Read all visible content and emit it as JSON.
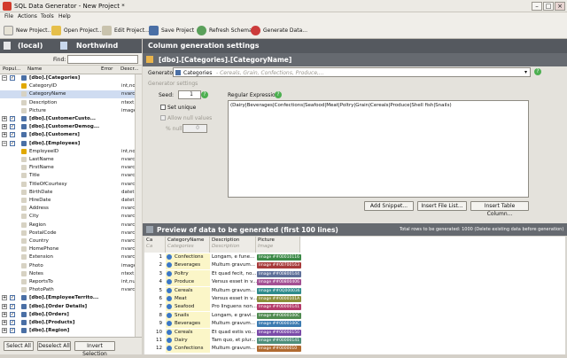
{
  "window": {
    "title": "SQL Data Generator - New Project *"
  },
  "menu": [
    "File",
    "Actions",
    "Tools",
    "Help"
  ],
  "toolbar": {
    "new": "New Project...",
    "open": "Open Project...",
    "edit": "Edit Project...",
    "save": "Save Project",
    "refresh": "Refresh Schema",
    "generate": "Generate Data..."
  },
  "left": {
    "server": "(local)",
    "database": "Northwind",
    "filter_label": "Find:",
    "columns": [
      "Popul...",
      "Name",
      "Error",
      "Descr..."
    ],
    "rows": [
      {
        "kind": "table",
        "name": "[dbo].[Categories]",
        "expanded": true,
        "checked": true
      },
      {
        "kind": "col",
        "name": "CategoryID",
        "type": "int,not"
      },
      {
        "kind": "col",
        "name": "CategoryName",
        "type": "nvarch",
        "selected": true
      },
      {
        "kind": "col",
        "name": "Description",
        "type": "ntext,n"
      },
      {
        "kind": "col",
        "name": "Picture",
        "type": "image,"
      },
      {
        "kind": "table",
        "name": "[dbo].[CustomerCusto...",
        "expanded": false,
        "checked": true
      },
      {
        "kind": "table",
        "name": "[dbo].[CustomerDemog...",
        "expanded": false,
        "checked": true
      },
      {
        "kind": "table",
        "name": "[dbo].[Customers]",
        "expanded": false,
        "checked": true
      },
      {
        "kind": "table",
        "name": "[dbo].[Employees]",
        "expanded": true,
        "checked": true
      },
      {
        "kind": "col",
        "name": "EmployeeID",
        "type": "int,not"
      },
      {
        "kind": "col",
        "name": "LastName",
        "type": "nvarch"
      },
      {
        "kind": "col",
        "name": "FirstName",
        "type": "nvarch"
      },
      {
        "kind": "col",
        "name": "Title",
        "type": "nvarch"
      },
      {
        "kind": "col",
        "name": "TitleOfCourtesy",
        "type": "nvarch"
      },
      {
        "kind": "col",
        "name": "BirthDate",
        "type": "datetin"
      },
      {
        "kind": "col",
        "name": "HireDate",
        "type": "datetin"
      },
      {
        "kind": "col",
        "name": "Address",
        "type": "nvarch"
      },
      {
        "kind": "col",
        "name": "City",
        "type": "nvarch"
      },
      {
        "kind": "col",
        "name": "Region",
        "type": "nvarch"
      },
      {
        "kind": "col",
        "name": "PostalCode",
        "type": "nvarch"
      },
      {
        "kind": "col",
        "name": "Country",
        "type": "nvarch"
      },
      {
        "kind": "col",
        "name": "HomePhone",
        "type": "nvarch"
      },
      {
        "kind": "col",
        "name": "Extension",
        "type": "nvarch"
      },
      {
        "kind": "col",
        "name": "Photo",
        "type": "image,"
      },
      {
        "kind": "col",
        "name": "Notes",
        "type": "ntext,n"
      },
      {
        "kind": "col",
        "name": "ReportsTo",
        "type": "int,null"
      },
      {
        "kind": "col",
        "name": "PhotoPath",
        "type": "nvarch"
      },
      {
        "kind": "table",
        "name": "[dbo].[EmployeeTerrito...",
        "expanded": false,
        "checked": true
      },
      {
        "kind": "table",
        "name": "[dbo].[Order Details]",
        "expanded": false,
        "checked": true
      },
      {
        "kind": "table",
        "name": "[dbo].[Orders]",
        "expanded": false,
        "checked": true
      },
      {
        "kind": "table",
        "name": "[dbo].[Products]",
        "expanded": false,
        "checked": true
      },
      {
        "kind": "table",
        "name": "[dbo].[Region]",
        "expanded": false,
        "checked": true
      }
    ],
    "buttons": {
      "select_all": "Select All",
      "deselect_all": "Deselect All",
      "invert": "Invert Selection"
    }
  },
  "right": {
    "header": "Column generation settings",
    "column": "[dbo].[Categories].[CategoryName]",
    "generator_label": "Generator:",
    "generator_value": "Categories",
    "generator_hint": "- Cereals, Grain, Confections, Produce,...",
    "settings_label": "Generator settings",
    "seed_label": "Seed:",
    "seed_value": "1",
    "set_unique": "Set unique",
    "allow_null": "Allow null values",
    "null_pct_label": "% null:",
    "null_pct_value": "0",
    "regex_label": "Regular Expression:",
    "regex_value": "(Dairy|Beverages|Confections|Seafood|Meat|Poltry|Grain|Cereals|Produce|Shell fish|Snails)",
    "btn_snippet": "Add Snippet...",
    "btn_file_list": "Insert File List...",
    "btn_table_col": "Insert Table Column...",
    "preview_title": "Preview of data to be generated (first 100 lines)",
    "preview_info": "Total rows to be generated: 1000 (Delete existing data before generation)",
    "grid_headers": [
      {
        "t": "Ca",
        "s": "Ca"
      },
      {
        "t": "CategoryName",
        "s": "Categories"
      },
      {
        "t": "Description",
        "s": "Description"
      },
      {
        "t": "Picture",
        "s": "Image"
      }
    ],
    "grid_rows": [
      {
        "n": "1",
        "name": "Confections",
        "desc": "Longam, e fune...",
        "img": "Image ##00010116",
        "c": "#3c8a47"
      },
      {
        "n": "2",
        "name": "Beverages",
        "desc": "Multum gravum...",
        "img": "Image ##00700163",
        "c": "#a73a3a"
      },
      {
        "n": "3",
        "name": "Poltry",
        "desc": "Et quad fecit, no...",
        "img": "Image ##00800144",
        "c": "#5e6f99"
      },
      {
        "n": "4",
        "name": "Produce",
        "desc": "Versus esset in v...",
        "img": "Image ##00800406",
        "c": "#a34f93"
      },
      {
        "n": "5",
        "name": "Cereals",
        "desc": "Multum gravum...",
        "img": "Image ##0Q000036",
        "c": "#2f8c8c"
      },
      {
        "n": "6",
        "name": "Meat",
        "desc": "Versus esset in v...",
        "img": "Image ##0000101A",
        "c": "#8b8f3a"
      },
      {
        "n": "7",
        "name": "Seafood",
        "desc": "Pro linguens non...",
        "img": "Image ##00000141",
        "c": "#b43b6a"
      },
      {
        "n": "8",
        "name": "Snails",
        "desc": "Longam, e gravi...",
        "img": "Image ##0000100C",
        "c": "#4f8a4f"
      },
      {
        "n": "9",
        "name": "Beverages",
        "desc": "Multum gravum...",
        "img": "Image ##0000100C",
        "c": "#3b7ab0"
      },
      {
        "n": "10",
        "name": "Cereals",
        "desc": "Et quad estis vo...",
        "img": "Image ##00000150",
        "c": "#7a4aa8"
      },
      {
        "n": "11",
        "name": "Dairy",
        "desc": "Tam quo, et plur...",
        "img": "Image ##00000141",
        "c": "#4e8e7a"
      },
      {
        "n": "12",
        "name": "Confections",
        "desc": "Multum gravum...",
        "img": "Image ##0000010",
        "c": "#b06a30"
      }
    ]
  }
}
